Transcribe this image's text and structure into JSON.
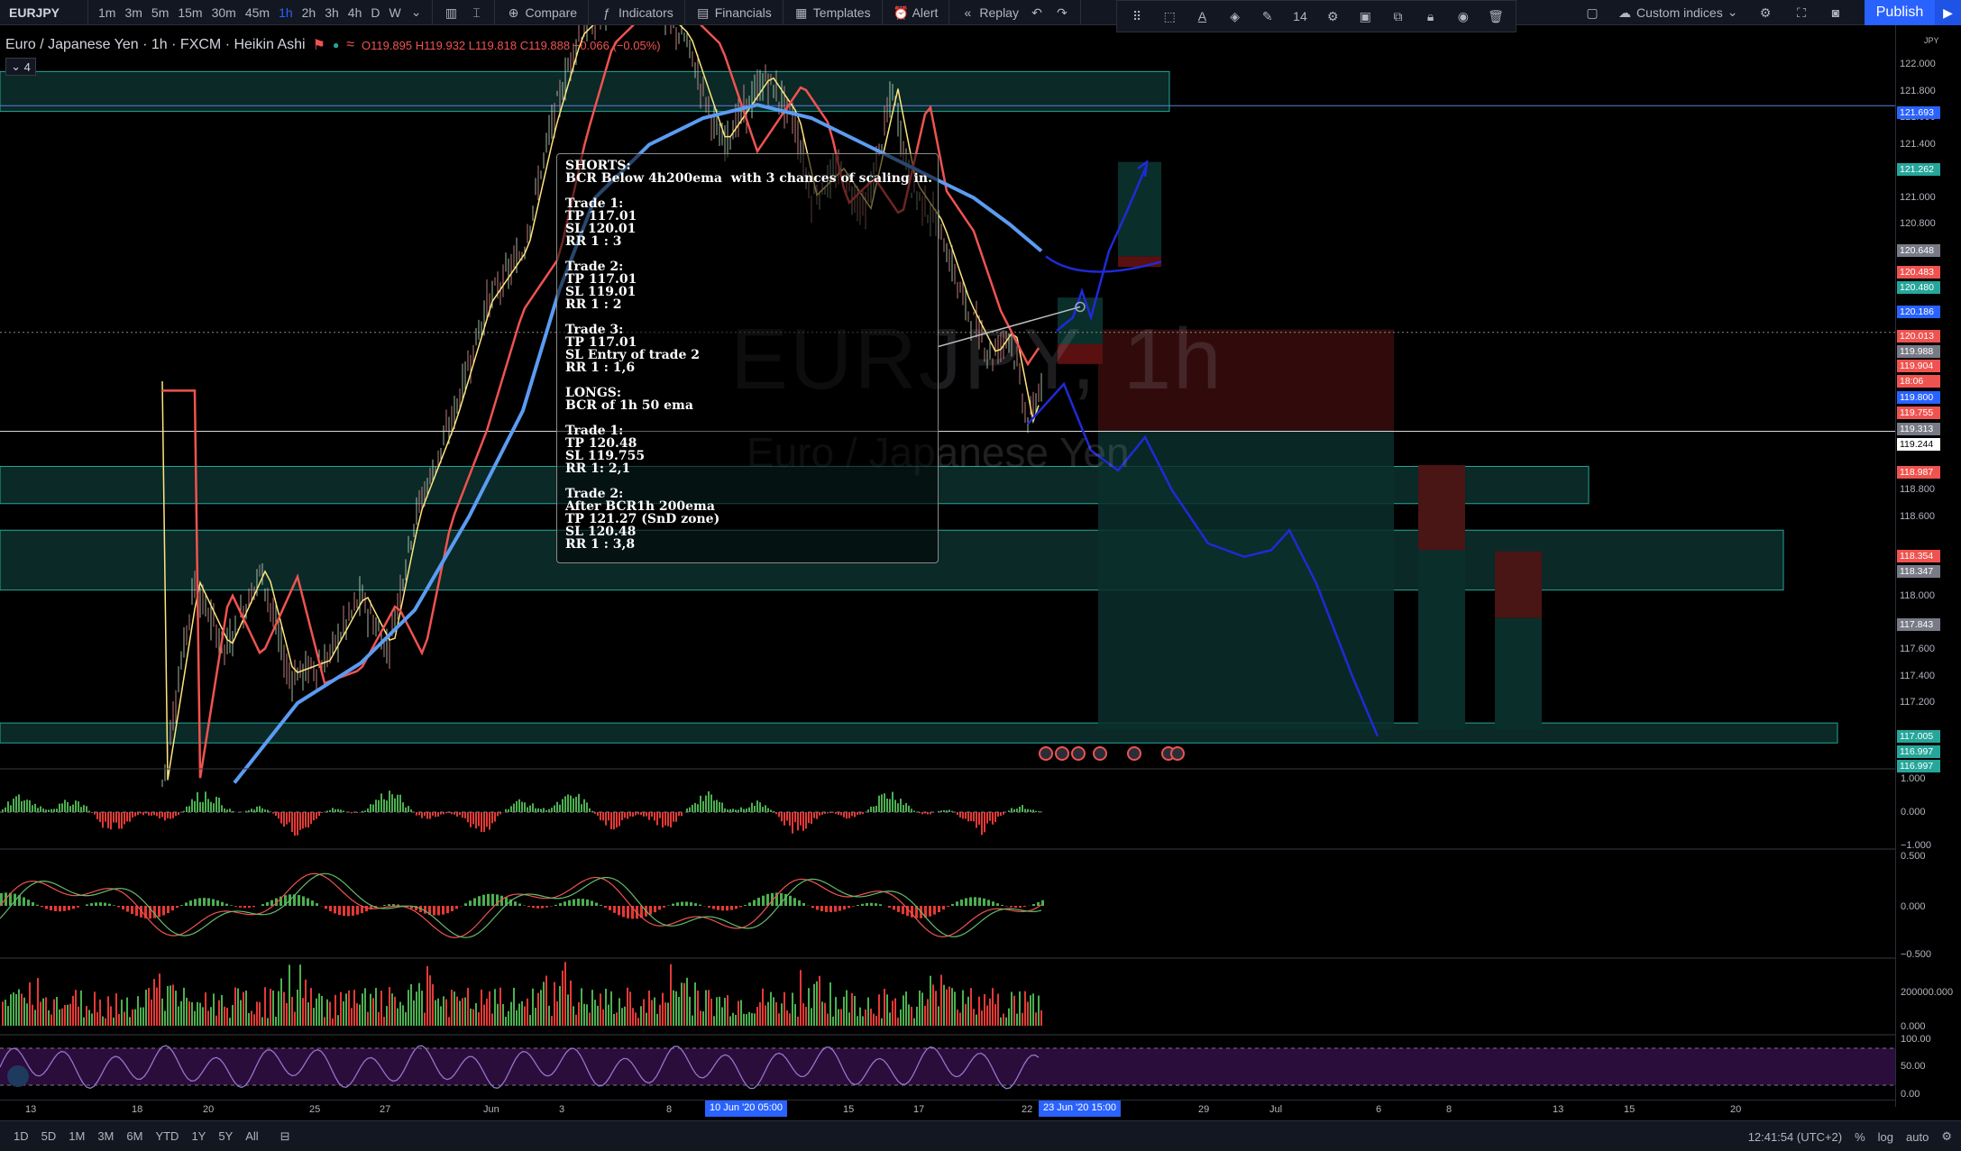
{
  "toolbar": {
    "symbol": "EURJPY",
    "intervals": [
      "1m",
      "3m",
      "5m",
      "15m",
      "30m",
      "45m",
      "1h",
      "2h",
      "3h",
      "4h",
      "D",
      "W"
    ],
    "active_interval": "1h",
    "compare_label": "Compare",
    "indicators_label": "Indicators",
    "financials_label": "Financials",
    "templates_label": "Templates",
    "alert_label": "Alert",
    "replay_label": "Replay",
    "font_size": "14",
    "custom_indices_label": "Custom indices",
    "publish_label": "Publish"
  },
  "legend": {
    "title": "Euro / Japanese Yen · 1h · FXCM · Heikin Ashi",
    "open": "O119.895",
    "high": "H119.932",
    "low": "L119.818",
    "close": "C119.888",
    "change": "−0.066 (−0.05%)",
    "collapse_count": "4"
  },
  "watermark": {
    "symbol": "EURJPY, 1h",
    "name": "Euro / Japanese Yen"
  },
  "note": "SHORTS:\nBCR Below 4h200ema  with 3 chances of scaling in.\n\nTrade 1:\nTP 117.01\nSL 120.01\nRR 1 : 3\n\nTrade 2:\nTP 117.01\nSL 119.01\nRR 1 : 2\n\nTrade 3:\nTP 117.01\nSL Entry of trade 2\nRR 1 : 1,6\n\nLONGS:\nBCR of 1h 50 ema\n\nTrade 1:\nTP 120.48\nSL 119.755\nRR 1: 2,1\n\nTrade 2:\nAfter BCR1h 200ema\nTP 121.27 (SnD zone)\nSL 120.48\nRR 1 : 3,8",
  "price_axis": {
    "currency": "JPY",
    "labels": [
      "122.000",
      "121.800",
      "121.600",
      "121.400",
      "121.200",
      "121.000",
      "120.800",
      "118.800",
      "118.600",
      "118.200",
      "118.000",
      "117.600",
      "117.400",
      "117.200"
    ],
    "tags": [
      {
        "value": "121.693",
        "color": "#2962ff"
      },
      {
        "value": "121.262",
        "color": "#26a69a"
      },
      {
        "value": "120.648",
        "color": "#787b86"
      },
      {
        "value": "120.483",
        "color": "#ef5350"
      },
      {
        "value": "120.480",
        "color": "#26a69a"
      },
      {
        "value": "120.186",
        "color": "#2962ff"
      },
      {
        "value": "120.013",
        "color": "#ef5350"
      },
      {
        "value": "119.988",
        "color": "#787b86"
      },
      {
        "value": "119.904",
        "color": "#ef5350"
      },
      {
        "value": "18:06",
        "color": "#ef5350"
      },
      {
        "value": "119.800",
        "color": "#2962ff"
      },
      {
        "value": "119.755",
        "color": "#ef5350"
      },
      {
        "value": "119.313",
        "color": "#787b86"
      },
      {
        "value": "119.244",
        "color": "#ffffff"
      },
      {
        "value": "118.987",
        "color": "#ef5350"
      },
      {
        "value": "118.354",
        "color": "#ef5350"
      },
      {
        "value": "118.347",
        "color": "#787b86"
      },
      {
        "value": "117.843",
        "color": "#787b86"
      },
      {
        "value": "117.005",
        "color": "#26a69a"
      },
      {
        "value": "116.997",
        "color": "#26a69a"
      },
      {
        "value": "116.997b",
        "color": "#26a69a"
      }
    ]
  },
  "indicator_axes": {
    "osc1": [
      "1.000",
      "0.000",
      "−1.000"
    ],
    "osc2": [
      "0.500",
      "0.000",
      "−0.500"
    ],
    "volume": [
      "200000.000",
      "0.000"
    ],
    "rsi": [
      "100.00",
      "50.00",
      "0.00"
    ]
  },
  "time_axis": {
    "labels": [
      "13",
      "18",
      "20",
      "25",
      "27",
      "Jun",
      "3",
      "8",
      "15",
      "17",
      "22",
      "29",
      "Jul",
      "6",
      "8",
      "13",
      "15",
      "20"
    ],
    "tag1": "10 Jun '20   05:00",
    "tag2": "23 Jun '20   15:00"
  },
  "bottombar": {
    "ranges": [
      "1D",
      "5D",
      "1M",
      "3M",
      "6M",
      "YTD",
      "1Y",
      "5Y",
      "All"
    ],
    "clock": "12:41:54 (UTC+2)",
    "percent": "%",
    "log": "log",
    "auto": "auto"
  },
  "colors": {
    "bg": "#000000",
    "zone_fill": "#0b2e2b",
    "zone_border": "#26a69a",
    "ema_blue": "#5b9cf2",
    "ema_red": "#ef5350",
    "price_yellow": "#ffe57f",
    "projection": "#1e2bd6"
  }
}
